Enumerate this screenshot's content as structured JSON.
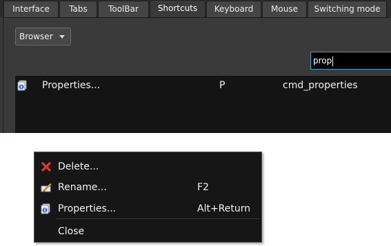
{
  "tabs": [
    {
      "label": "Interface",
      "active": false
    },
    {
      "label": "Tabs",
      "active": false
    },
    {
      "label": "ToolBar",
      "active": false
    },
    {
      "label": "Shortcuts",
      "active": true
    },
    {
      "label": "Keyboard",
      "active": false
    },
    {
      "label": "Mouse",
      "active": false
    },
    {
      "label": "Switching mode",
      "active": false
    }
  ],
  "shortcuts_page": {
    "context_dropdown": {
      "value": "Browser"
    },
    "search": {
      "value": "prop"
    },
    "results": [
      {
        "name": "Properties...",
        "key": "P",
        "command": "cmd_properties",
        "icon": "properties-icon"
      }
    ]
  },
  "context_menu": {
    "items": [
      {
        "label": "Delete...",
        "shortcut": "",
        "icon": "delete-icon"
      },
      {
        "label": "Rename...",
        "shortcut": "F2",
        "icon": "rename-icon"
      },
      {
        "label": "Properties...",
        "shortcut": "Alt+Return",
        "icon": "properties-icon"
      },
      {
        "label": "Close",
        "shortcut": "",
        "icon": ""
      }
    ]
  },
  "colors": {
    "panel_bg": "#3a3a3a",
    "list_bg": "#141414",
    "menu_bg": "#161616",
    "search_focus_border": "#3fa0d0",
    "delete_icon": "#d23a2e"
  }
}
